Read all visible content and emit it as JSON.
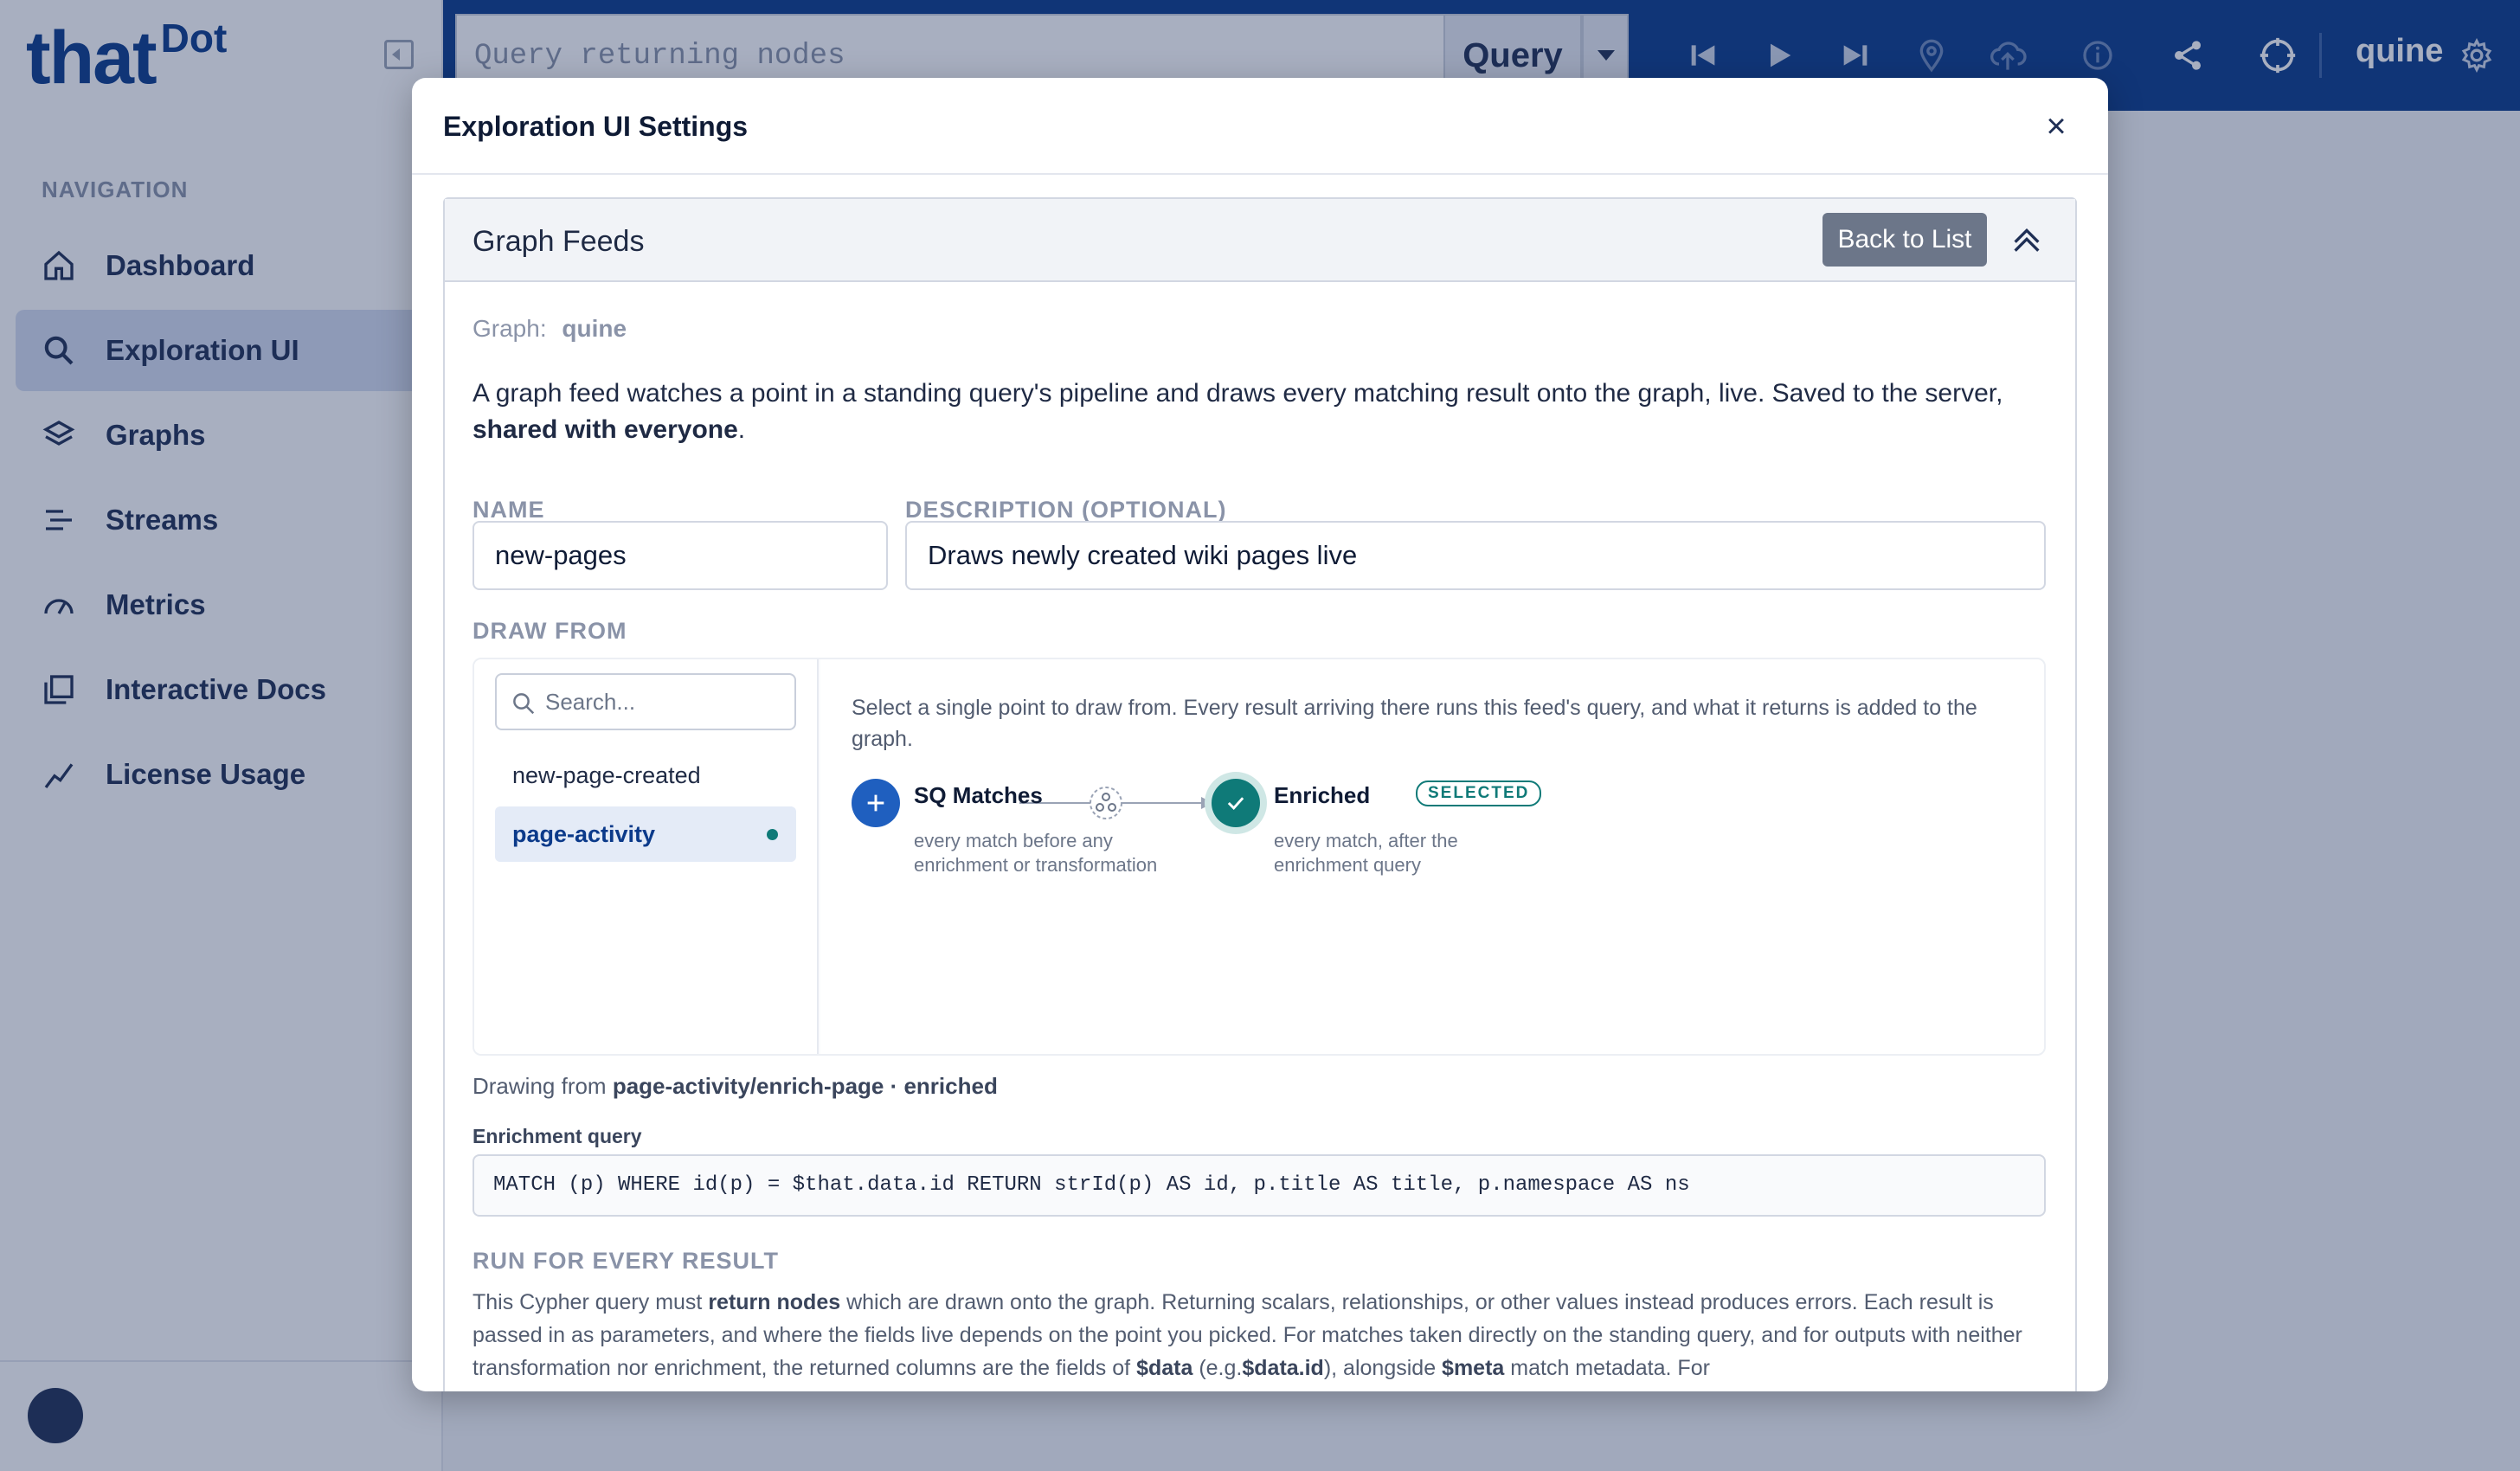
{
  "app": {
    "logo_main": "that",
    "logo_sup": "Dot",
    "nav_heading": "NAVIGATION",
    "nav_items": [
      {
        "label": "Dashboard",
        "icon": "home-icon"
      },
      {
        "label": "Exploration UI",
        "icon": "search-icon"
      },
      {
        "label": "Graphs",
        "icon": "layers-icon"
      },
      {
        "label": "Streams",
        "icon": "streams-icon"
      },
      {
        "label": "Metrics",
        "icon": "gauge-icon"
      },
      {
        "label": "Interactive Docs",
        "icon": "docs-icon"
      },
      {
        "label": "License Usage",
        "icon": "chart-line-icon"
      }
    ],
    "active_nav": "Exploration UI"
  },
  "topbar": {
    "query_placeholder": "Query returning nodes",
    "query_button": "Query",
    "user": "quine",
    "icons": [
      "skip-back-icon",
      "play-icon",
      "skip-forward-icon",
      "pin-icon",
      "cloud-upload-icon",
      "info-icon",
      "share-icon",
      "crosshair-icon",
      "gear-icon"
    ]
  },
  "modal": {
    "title": "Exploration UI Settings",
    "close": "×",
    "panel": {
      "title": "Graph Feeds",
      "back_button": "Back to List",
      "graph_label": "Graph:",
      "graph_name": "quine",
      "desc_text": "A graph feed watches a point in a standing query's pipeline and draws every matching result onto the graph, live. Saved to the server,",
      "desc_bold": "shared with everyone",
      "desc_end": ".",
      "name_label": "NAME",
      "name_value": "new-pages",
      "description_label": "DESCRIPTION (OPTIONAL)",
      "description_value": "Draws newly created wiki pages live",
      "draw_from_label": "DRAW FROM",
      "search_placeholder": "Search...",
      "queries": [
        {
          "label": "new-page-created",
          "selected": false
        },
        {
          "label": "page-activity",
          "selected": true
        }
      ],
      "instruction": "Select a single point to draw from. Every result arriving there runs this feed's query, and what it returns is added to the graph.",
      "points": [
        {
          "title": "SQ Matches",
          "sub": "every match before any enrichment or transformation"
        },
        {
          "title": "Enriched",
          "sub": "every match, after the enrichment query",
          "badge": "SELECTED"
        }
      ],
      "drawing_from_prefix": "Drawing from",
      "drawing_from_value": "page-activity/enrich-page · enriched",
      "enrichment_label": "Enrichment query",
      "enrichment_query": "MATCH (p) WHERE id(p) = $that.data.id RETURN strId(p) AS id, p.title AS title, p.namespace AS ns",
      "run_label": "RUN FOR EVERY RESULT",
      "run_t1": "This Cypher query must",
      "run_b1": "return nodes",
      "run_t2": "which are drawn onto the graph. Returning scalars, relationships, or other values instead produces errors. Each result is passed in as parameters, and where the fields live depends on the point you picked. For matches taken directly on the standing query, and for outputs with neither transformation nor enrichment, the returned columns are the fields of",
      "run_b2": "$data",
      "run_t3": "(e.g.",
      "run_b3": "$data.id",
      "run_t4": "), alongside",
      "run_b4": "$meta",
      "run_t5": "match metadata. For"
    }
  },
  "colors": {
    "brand": "#0b3a8a",
    "selected_green": "#0f7a78",
    "point_blue": "#1f5fbf"
  }
}
